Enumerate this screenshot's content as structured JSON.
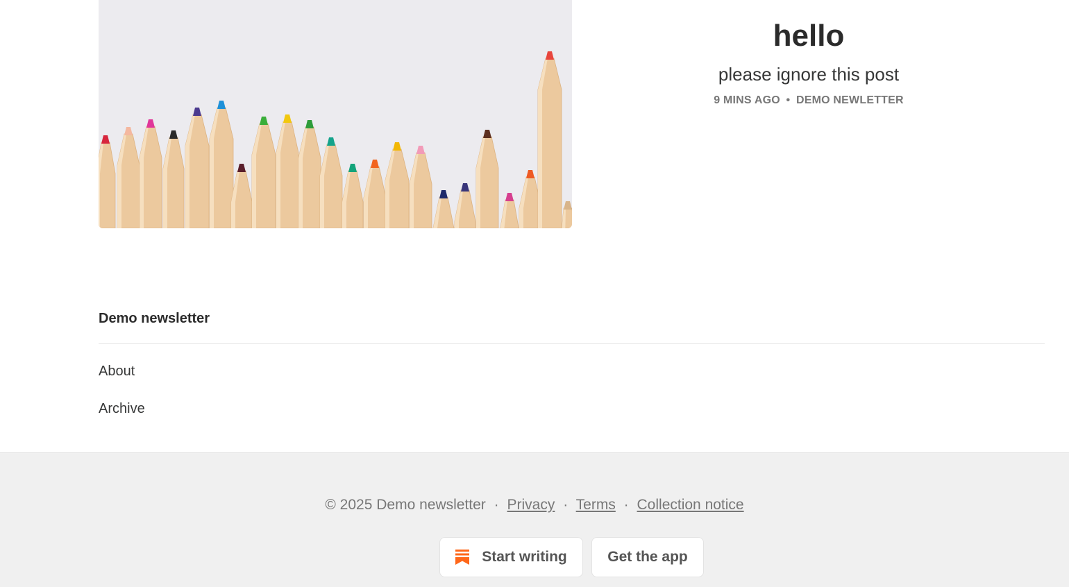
{
  "post": {
    "title": "hello",
    "subtitle": "please ignore this post",
    "meta": {
      "time": "9 MINS AGO",
      "separator": "•",
      "publication": "DEMO NEWLETTER"
    },
    "image": {
      "icon": "colored-pencils-image"
    }
  },
  "publication": {
    "name": "Demo newsletter",
    "nav": [
      {
        "label": "About"
      },
      {
        "label": "Archive"
      }
    ]
  },
  "footer": {
    "copyright": "© 2025 Demo newsletter",
    "separator": "·",
    "links": {
      "privacy": "Privacy",
      "terms": "Terms",
      "collection": "Collection notice"
    },
    "buttons": {
      "start_writing": "Start writing",
      "get_app": "Get the app"
    },
    "brand_color": "#ff6719"
  }
}
